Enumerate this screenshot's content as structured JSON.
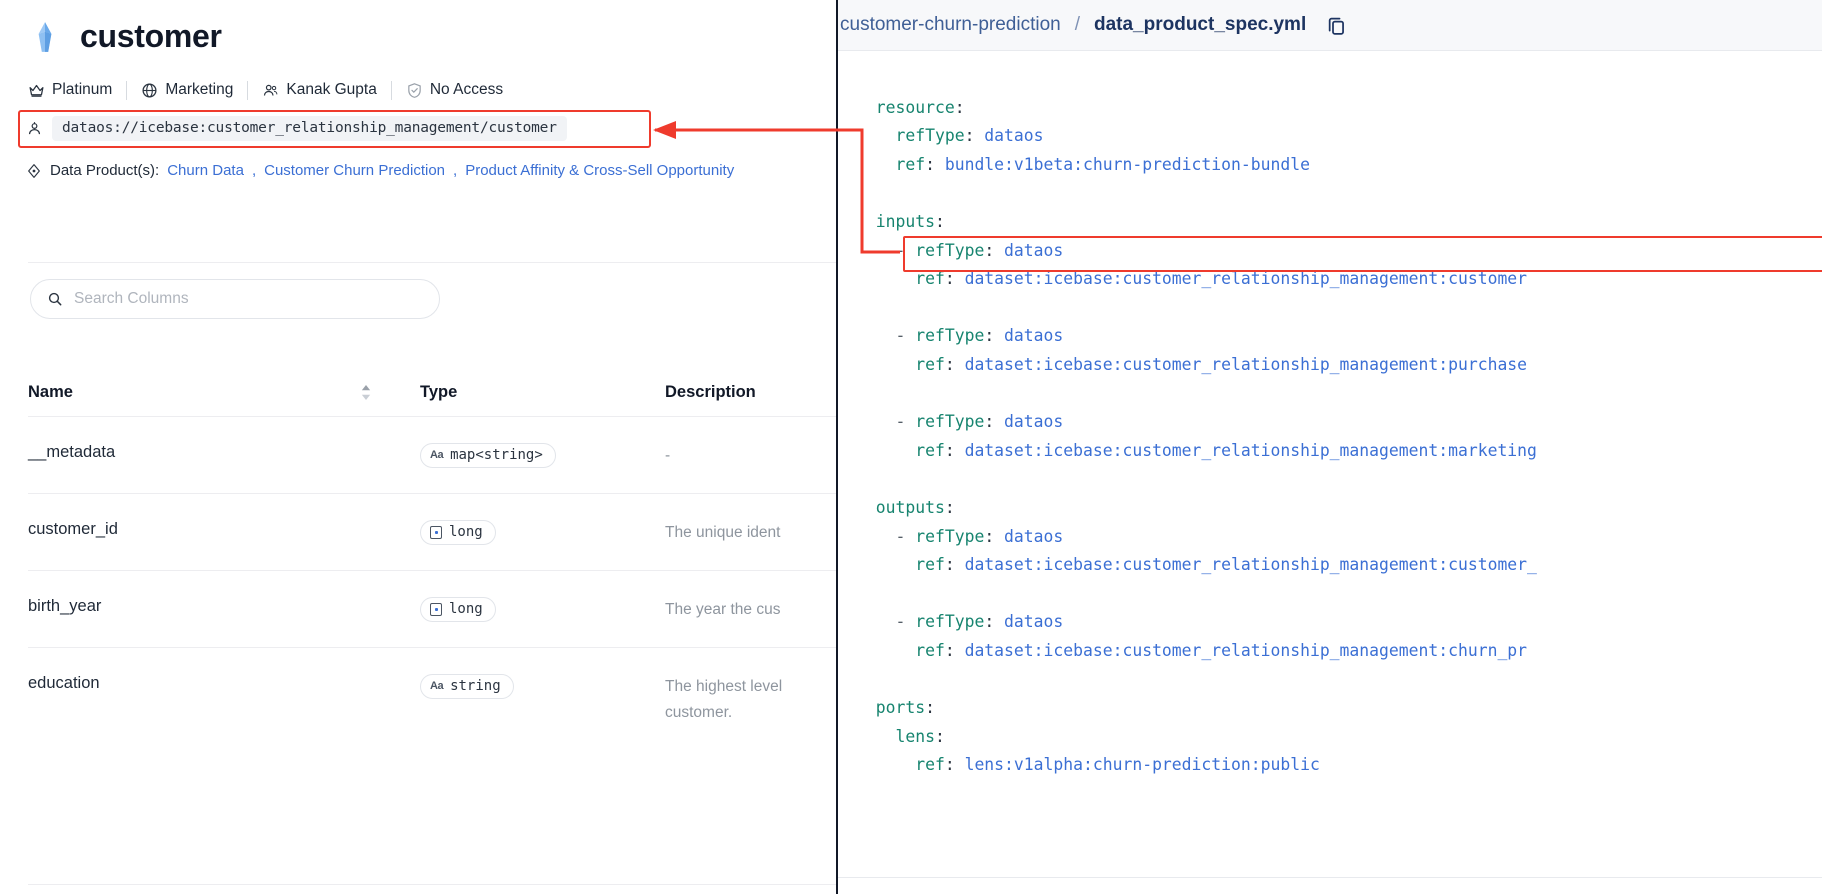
{
  "left": {
    "title": "customer",
    "title_icon": "iceberg-icon",
    "meta": [
      {
        "icon": "crown-icon",
        "label": "Platinum"
      },
      {
        "icon": "globe-icon",
        "label": "Marketing"
      },
      {
        "icon": "users-icon",
        "label": "Kanak Gupta"
      },
      {
        "icon": "shield-check-icon",
        "label": "No Access"
      }
    ],
    "address": {
      "icon": "dataset-address-icon",
      "value": "dataos://icebase:customer_relationship_management/customer"
    },
    "data_products": {
      "icon": "data-product-icon",
      "label": "Data Product(s):",
      "links": [
        "Churn Data",
        "Customer Churn Prediction",
        "Product Affinity & Cross-Sell Opportunity"
      ],
      "separator": ", "
    },
    "search": {
      "icon": "search-icon",
      "placeholder": "Search Columns",
      "value": ""
    },
    "table": {
      "headers": {
        "name": "Name",
        "type": "Type",
        "description": "Description"
      },
      "sort_icon": "sort-updown-icon",
      "rows": [
        {
          "name": "__metadata",
          "type": "map<string>",
          "type_glyph": "Aa",
          "type_glyph_kind": "text",
          "description": "-"
        },
        {
          "name": "customer_id",
          "type": "long",
          "type_glyph": "",
          "type_glyph_kind": "number",
          "description": "The unique ident"
        },
        {
          "name": "birth_year",
          "type": "long",
          "type_glyph": "",
          "type_glyph_kind": "number",
          "description": "The year the cus"
        },
        {
          "name": "education",
          "type": "string",
          "type_glyph": "Aa",
          "type_glyph_kind": "text",
          "description": "The highest level customer."
        }
      ]
    }
  },
  "right": {
    "breadcrumb": {
      "repo": "customer-churn-prediction",
      "separator": "/",
      "file": "data_product_spec.yml"
    },
    "copy_icon": "copy-icon",
    "yaml_lines": [
      {
        "indent": 0,
        "text": ""
      },
      {
        "indent": 2,
        "key": "resource",
        "value": ""
      },
      {
        "indent": 4,
        "key": "refType",
        "value": "dataos"
      },
      {
        "indent": 4,
        "key": "ref",
        "value": "bundle:v1beta:churn-prediction-bundle"
      },
      {
        "indent": 0,
        "text": ""
      },
      {
        "indent": 2,
        "key": "inputs",
        "value": ""
      },
      {
        "indent": 4,
        "dash": true,
        "key": "refType",
        "value": "dataos"
      },
      {
        "indent": 6,
        "key": "ref",
        "value": "dataset:icebase:customer_relationship_management:customer",
        "highlight": true
      },
      {
        "indent": 0,
        "text": ""
      },
      {
        "indent": 4,
        "dash": true,
        "key": "refType",
        "value": "dataos"
      },
      {
        "indent": 6,
        "key": "ref",
        "value": "dataset:icebase:customer_relationship_management:purchase"
      },
      {
        "indent": 0,
        "text": ""
      },
      {
        "indent": 4,
        "dash": true,
        "key": "refType",
        "value": "dataos"
      },
      {
        "indent": 6,
        "key": "ref",
        "value": "dataset:icebase:customer_relationship_management:marketing"
      },
      {
        "indent": 0,
        "text": ""
      },
      {
        "indent": 2,
        "key": "outputs",
        "value": ""
      },
      {
        "indent": 4,
        "dash": true,
        "key": "refType",
        "value": "dataos"
      },
      {
        "indent": 6,
        "key": "ref",
        "value": "dataset:icebase:customer_relationship_management:customer_"
      },
      {
        "indent": 0,
        "text": ""
      },
      {
        "indent": 4,
        "dash": true,
        "key": "refType",
        "value": "dataos"
      },
      {
        "indent": 6,
        "key": "ref",
        "value": "dataset:icebase:customer_relationship_management:churn_pr"
      },
      {
        "indent": 0,
        "text": ""
      },
      {
        "indent": 2,
        "key": "ports",
        "value": ""
      },
      {
        "indent": 4,
        "key": "lens",
        "value": ""
      },
      {
        "indent": 6,
        "key": "ref",
        "value": "lens:v1alpha:churn-prediction:public"
      }
    ]
  },
  "annotation": {
    "arrow_color": "#ef3b2d",
    "description": "red connector linking highlighted dataset address to highlighted yaml ref line"
  },
  "colors": {
    "accent_link": "#3b6fd4",
    "yaml_key": "#17846f",
    "yaml_value": "#3b6fd4",
    "highlight_red": "#ef3b2d",
    "text_primary": "#111827",
    "text_muted": "#8e959e"
  }
}
